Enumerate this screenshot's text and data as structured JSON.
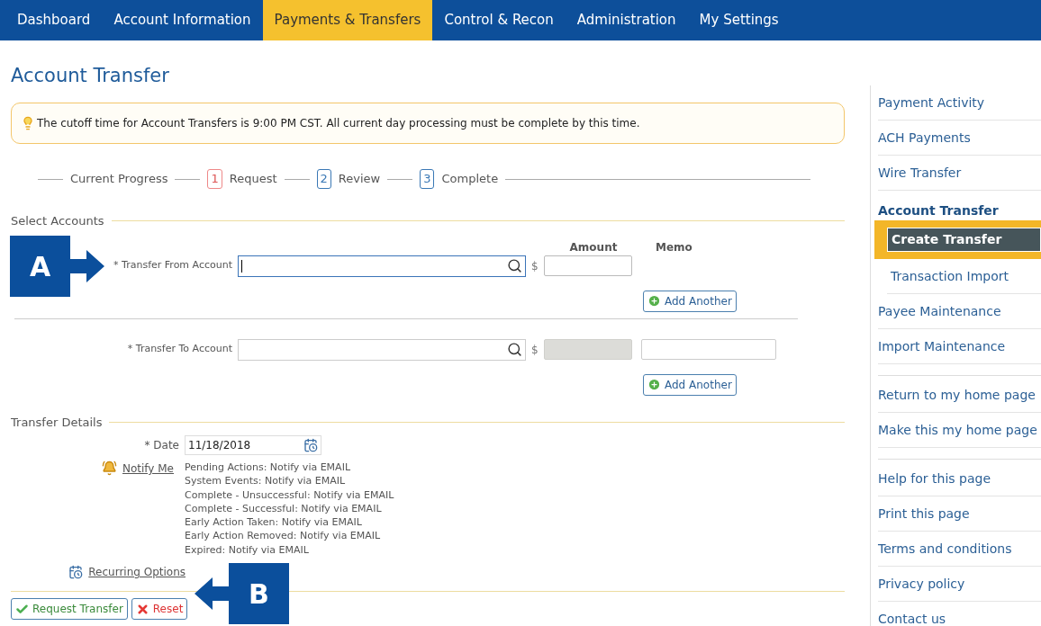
{
  "nav": [
    {
      "label": "Dashboard",
      "selected": false
    },
    {
      "label": "Account Information",
      "selected": false
    },
    {
      "label": "Payments & Transfers",
      "selected": true
    },
    {
      "label": "Control & Recon",
      "selected": false
    },
    {
      "label": "Administration",
      "selected": false
    },
    {
      "label": "My Settings",
      "selected": false
    }
  ],
  "page_title": "Account Transfer",
  "notice": {
    "text": "The cutoff time for Account Transfers is 9:00 PM CST. All current day processing must be complete by this time."
  },
  "progress": {
    "label": "Current Progress",
    "steps": [
      {
        "number": "1",
        "label": "Request",
        "selected": true
      },
      {
        "number": "2",
        "label": "Review",
        "selected": false
      },
      {
        "number": "3",
        "label": "Complete",
        "selected": false
      }
    ]
  },
  "select_accounts": {
    "legend": "Select Accounts",
    "amount_header": "Amount",
    "memo_header": "Memo",
    "rows": [
      {
        "label": "* Transfer From Account",
        "focused": true,
        "currency": "$",
        "amount_disabled": false,
        "memo_field": false,
        "add_button": "Add Another"
      },
      {
        "label": "* Transfer To Account",
        "focused": false,
        "currency": "$",
        "amount_disabled": true,
        "memo_field": true,
        "add_button": "Add Another"
      }
    ]
  },
  "transfer_details": {
    "legend": "Transfer Details",
    "date": {
      "label": "* Date",
      "value": "11/18/2018"
    },
    "notify": {
      "link": "Notify Me",
      "lines": [
        "Pending Actions: Notify via EMAIL",
        "System Events: Notify via EMAIL",
        "Complete - Unsuccessful: Notify via EMAIL",
        "Complete - Successful: Notify via EMAIL",
        "Early Action Taken: Notify via EMAIL",
        "Early Action Removed: Notify via EMAIL",
        "Expired: Notify via EMAIL"
      ]
    },
    "recurring": {
      "link": "Recurring Options"
    }
  },
  "buttons": [
    {
      "label": "Request Transfer",
      "kind": "submit"
    },
    {
      "label": "Reset",
      "kind": "reset"
    }
  ],
  "sidebar": {
    "groups": [
      {
        "items": [
          {
            "label": "Payment Activity",
            "selected": false
          },
          {
            "label": "ACH Payments",
            "selected": false
          },
          {
            "label": "Wire Transfer",
            "selected": false
          },
          {
            "label": "Account Transfer",
            "selected": false,
            "children": [
              {
                "label": "Create Transfer",
                "selected": true
              },
              {
                "label": "Transaction Import",
                "selected": false
              }
            ]
          },
          {
            "label": "Payee Maintenance",
            "selected": false
          },
          {
            "label": "Import Maintenance",
            "selected": false
          }
        ]
      },
      {
        "items": [
          {
            "label": "Return to my home page",
            "selected": false
          },
          {
            "label": "Make this my home page",
            "selected": false
          }
        ]
      },
      {
        "items": [
          {
            "label": "Help for this page",
            "selected": false
          },
          {
            "label": "Print this page",
            "selected": false
          },
          {
            "label": "Terms and conditions",
            "selected": false
          },
          {
            "label": "Privacy policy",
            "selected": false
          },
          {
            "label": "Contact us",
            "selected": false
          }
        ]
      }
    ]
  },
  "callouts": [
    {
      "letter": "A",
      "kind": "rightward"
    },
    {
      "letter": "B",
      "kind": "leftward"
    }
  ]
}
